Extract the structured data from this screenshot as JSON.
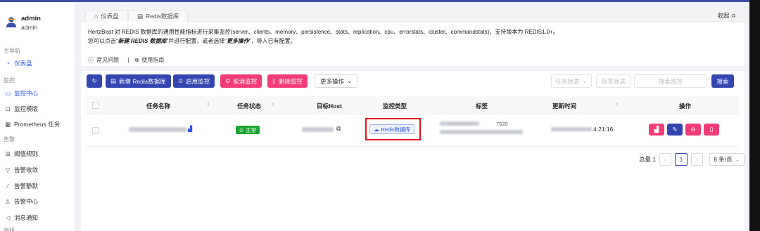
{
  "sidebar": {
    "user": {
      "name": "admin",
      "role": "admin"
    },
    "sections": [
      {
        "label": "主导航"
      },
      {
        "label": "监控"
      },
      {
        "label": "告警"
      },
      {
        "label": "高级"
      }
    ],
    "items": [
      {
        "label": "仪表盘",
        "icon": "dashboard-icon"
      },
      {
        "label": "监控中心",
        "icon": "laptop-icon"
      },
      {
        "label": "监控模版",
        "icon": "template-icon"
      },
      {
        "label": "Prometheus 任务",
        "icon": "grid-icon"
      },
      {
        "label": "阈值规则",
        "icon": "calculator-icon"
      },
      {
        "label": "告警收敛",
        "icon": "filter-icon"
      },
      {
        "label": "告警静默",
        "icon": "mute-icon"
      },
      {
        "label": "告警中心",
        "icon": "bell-icon"
      },
      {
        "label": "消息通知",
        "icon": "notification-icon"
      }
    ],
    "accent": "#2f54eb"
  },
  "header": {
    "tabs": [
      {
        "label": "仪表盘",
        "icon": "home-icon"
      },
      {
        "label": "Redis数据库",
        "icon": "database-icon"
      }
    ],
    "collapse_label": "收起 ≎"
  },
  "intro": {
    "line1": "HertzBeat 对 REDIS 数据库的通用性能指标进行采集监控(server、clients、memory、persistence、stats、replication、cpu、errorstats、cluster、commandstats)，支持版本为 REDIS1.0+。",
    "line2_pre": "您可以点击“",
    "line2_em1": "新建 REDIS 数据库",
    "line2_mid": "”并进行配置，或者选择“",
    "line2_em2": "更多操作",
    "line2_post": "”，导入已有配置。",
    "faq": "常见问题",
    "sep": "|",
    "guide": "使用指南"
  },
  "toolbar": {
    "refresh": "↻",
    "add": "新增 Redis数据库",
    "enable": "启用监控",
    "cancel": "取消监控",
    "delete": "删除监控",
    "more": "更多操作",
    "status_filter": "任务状态",
    "tag_filter": "标签筛选",
    "search_placeholder": "搜索监控",
    "search": "搜索"
  },
  "table": {
    "columns": [
      "任务名称",
      "任务状态",
      "目标Host",
      "监控类型",
      "标签",
      "更新时间",
      "操作"
    ],
    "rows": [
      {
        "status": "正常",
        "type": "Redis数据库",
        "tag_tail": "7520",
        "time_tail": "4:21:16"
      }
    ]
  },
  "pagination": {
    "total": "总量 1",
    "page": "1",
    "page_size": "8 条/页"
  },
  "colors": {
    "primary": "#3346b0",
    "danger": "#f23c7a",
    "success": "#1aa532",
    "highlight": "#e3121a"
  }
}
